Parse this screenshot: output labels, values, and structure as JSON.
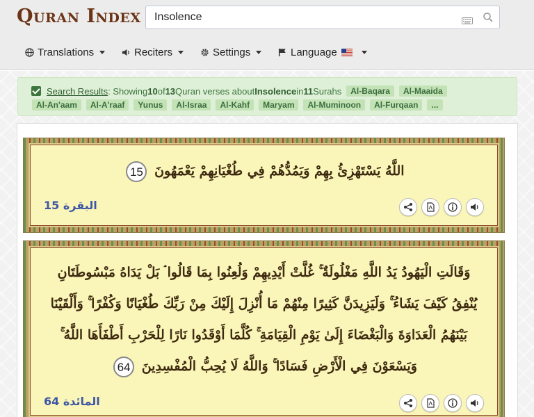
{
  "header": {
    "logo": "Quran Index",
    "search": {
      "value": "Insolence",
      "placeholder": ""
    },
    "nav": {
      "translations": "Translations",
      "reciters": "Reciters",
      "settings": "Settings",
      "language": "Language"
    }
  },
  "results": {
    "link": "Search Results",
    "prefix": ": Showing ",
    "shown": "10",
    "of": " of ",
    "total": "13",
    "about": " Quran verses about ",
    "term": "Insolence",
    "in": " in ",
    "surahs_count": "11",
    "surahs_label": " Surahs",
    "tags_row1": [
      "Al-Baqara",
      "Al-Maaida"
    ],
    "tags_row2": [
      "Al-An'aam",
      "Al-A'raaf",
      "Yunus",
      "Al-Israa",
      "Al-Kahf",
      "Maryam",
      "Al-Muminoon",
      "Al-Furqaan",
      "..."
    ]
  },
  "verses": [
    {
      "text": "اللَّهُ يَسْتَهْزِئُ بِهِمْ وَيَمُدُّهُمْ فِي طُغْيَانِهِمْ يَعْمَهُونَ",
      "number": "15",
      "ref_surah": "البقرة",
      "ref_num": "15"
    },
    {
      "text": "وَقَالَتِ الْيَهُودُ يَدُ اللَّهِ مَغْلُولَةٌ ۚ غُلَّتْ أَيْدِيهِمْ وَلُعِنُوا بِمَا قَالُوا ۘ بَلْ يَدَاهُ مَبْسُوطَتَانِ يُنْفِقُ كَيْفَ يَشَاءُ ۚ وَلَيَزِيدَنَّ كَثِيرًا مِنْهُمْ مَا أُنْزِلَ إِلَيْكَ مِنْ رَبِّكَ طُغْيَانًا وَكُفْرًا ۚ وَأَلْقَيْنَا بَيْنَهُمُ الْعَدَاوَةَ وَالْبَغْضَاءَ إِلَىٰ يَوْمِ الْقِيَامَةِ ۚ كُلَّمَا أَوْقَدُوا نَارًا لِلْحَرْبِ أَطْفَأَهَا اللَّهُ ۚ وَيَسْعَوْنَ فِي الْأَرْضِ فَسَادًا ۚ وَاللَّهُ لَا يُحِبُّ الْمُفْسِدِينَ",
      "number": "64",
      "ref_surah": "المائدة",
      "ref_num": "64"
    }
  ]
}
